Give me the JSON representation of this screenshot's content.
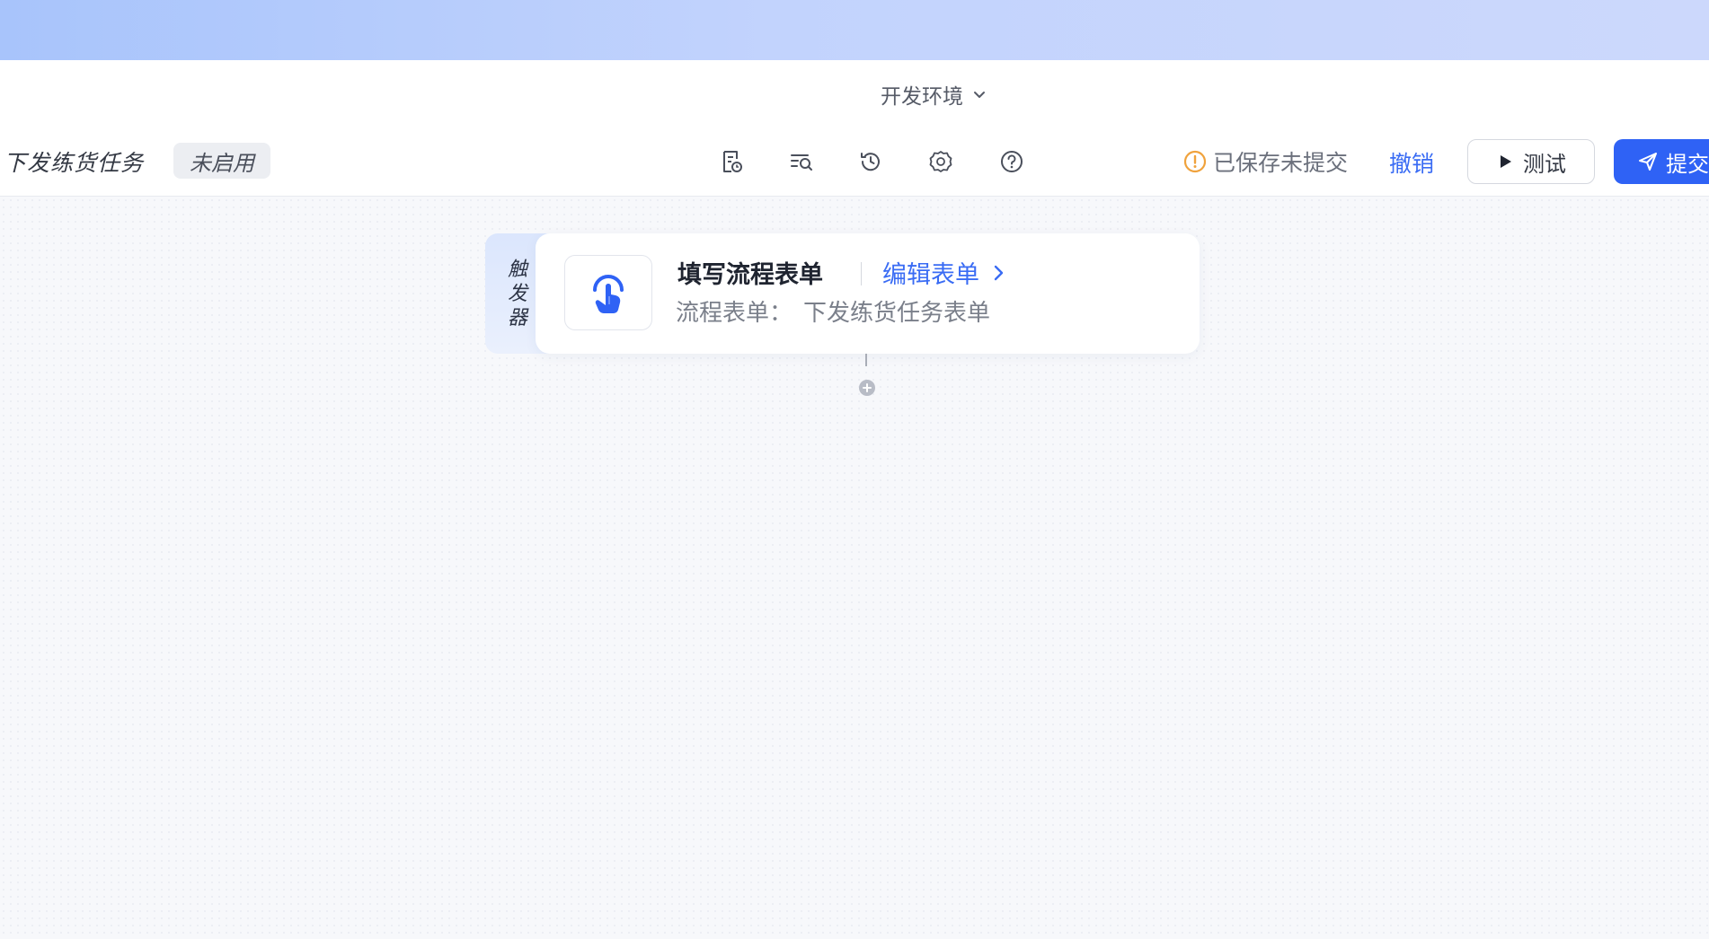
{
  "env_bar": {
    "env_label": "开发环境"
  },
  "toolbar": {
    "flow_name": "下发练货任务",
    "status_tag": "未启用",
    "icons": [
      "form-icon",
      "search-list-icon",
      "history-icon",
      "settings-icon",
      "help-icon"
    ],
    "save_state": "已保存未提交",
    "undo_label": "撤销",
    "test_label": "测试",
    "submit_label": "提交"
  },
  "canvas": {
    "trigger_node": {
      "tab_chars": [
        "触",
        "发",
        "器"
      ],
      "title": "填写流程表单",
      "edit_label": "编辑表单",
      "subtitle_label": "流程表单：",
      "subtitle_value": "下发练货任务表单",
      "icon": "hand-tap-icon"
    },
    "add_node_icon": "plus-circle-icon"
  },
  "colors": {
    "accent": "#3a6cf4",
    "submit_bg": "#2f62f5",
    "warning": "#f0a23c",
    "banner_start": "#a8c4fb",
    "banner_end": "#ccd8fc"
  }
}
